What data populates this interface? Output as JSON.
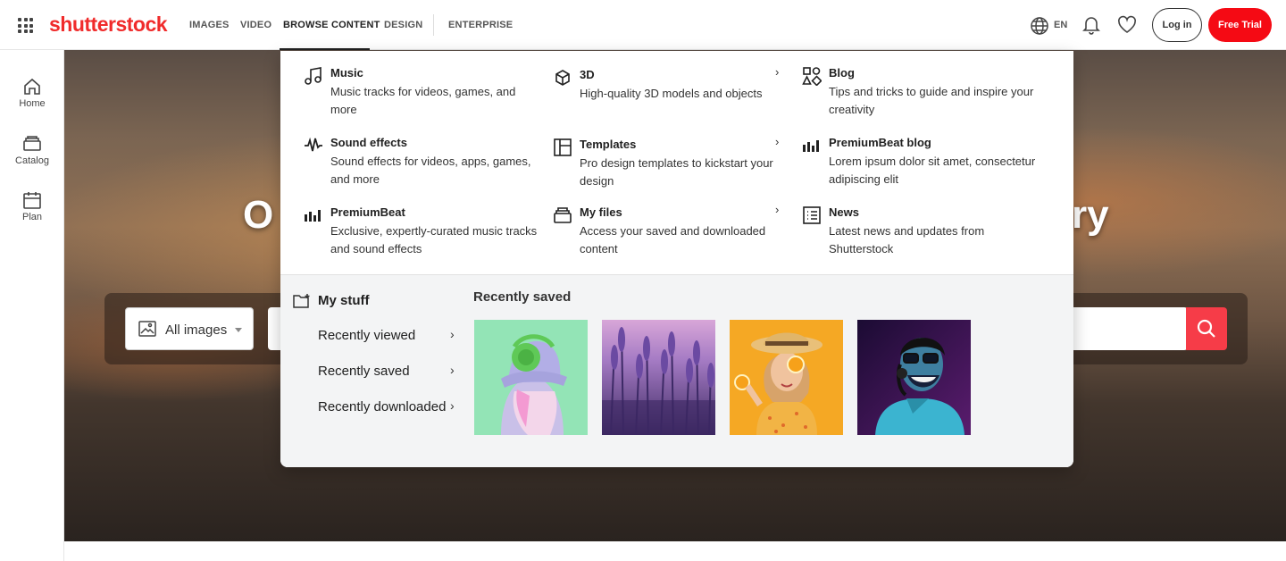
{
  "brand": {
    "logo": "shutterstock",
    "accent": "#f02b2b"
  },
  "nav": {
    "items": [
      "IMAGES",
      "VIDEO",
      "BROWSE CONTENT",
      "DESIGN",
      "ENTERPRISE"
    ],
    "active": "BROWSE CONTENT"
  },
  "header": {
    "language": "EN",
    "login": "Log in",
    "free_trial": "Free Trial"
  },
  "sidebar": {
    "items": [
      {
        "label": "Home",
        "icon": "home-icon"
      },
      {
        "label": "Catalog",
        "icon": "catalog-icon"
      },
      {
        "label": "Plan",
        "icon": "plan-icon"
      }
    ]
  },
  "hero": {
    "title_left": "O",
    "title_right": "ry"
  },
  "search": {
    "type_label": "All images",
    "placeholder": ""
  },
  "menu": {
    "columns": [
      [
        {
          "title": "Music",
          "desc": "Music tracks for videos, games, and more",
          "icon": "music-note-icon"
        },
        {
          "title": "Sound effects",
          "desc": "Sound effects for videos, apps, games, and more",
          "icon": "waveform-icon"
        },
        {
          "title": "PremiumBeat",
          "desc": "Exclusive, expertly-curated music tracks and sound effects",
          "icon": "premiumbeat-icon"
        }
      ],
      [
        {
          "title": "3D",
          "desc": "High-quality 3D models and objects",
          "icon": "3d-cube-icon"
        },
        {
          "title": "Templates",
          "desc": "Pro design templates to kickstart your design",
          "icon": "templates-icon"
        },
        {
          "title": "My files",
          "desc": "Access your saved and downloaded content",
          "icon": "files-icon"
        }
      ],
      [
        {
          "title": "Blog",
          "desc": "Tips and tricks to guide and inspire your creativity",
          "icon": "shapes-icon"
        },
        {
          "title": "PremiumBeat blog",
          "desc": "Lorem ipsum dolor sit amet, consectetur adipiscing elit",
          "icon": "premiumbeat-icon"
        },
        {
          "title": "News",
          "desc": "Latest news and updates from Shutterstock",
          "icon": "news-icon"
        }
      ]
    ],
    "chevron": "›",
    "my_stuff": {
      "title": "My stuff",
      "links": [
        "Recently viewed",
        "Recently saved",
        "Recently downloaded"
      ],
      "recent_heading": "Recently saved",
      "thumbs": [
        "girl-green-headphones",
        "lavender-field",
        "woman-orange-slices",
        "man-headphones-neon"
      ]
    }
  }
}
